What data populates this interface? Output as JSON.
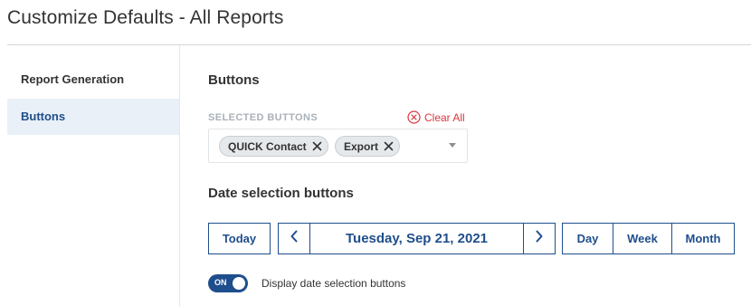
{
  "page": {
    "title": "Customize Defaults - All Reports"
  },
  "sidebar": {
    "items": [
      {
        "label": "Report Generation",
        "active": false
      },
      {
        "label": "Buttons",
        "active": true
      }
    ]
  },
  "buttons_section": {
    "title": "Buttons",
    "selected_label": "SELECTED BUTTONS",
    "clear_all": "Clear All",
    "chips": [
      "QUICK Contact",
      "Export"
    ]
  },
  "date_section": {
    "title": "Date selection buttons",
    "today": "Today",
    "date": "Tuesday, Sep 21, 2021",
    "views": [
      "Day",
      "Week",
      "Month"
    ],
    "toggle": {
      "state": "ON",
      "label": "Display date selection buttons"
    }
  },
  "colors": {
    "primary": "#1f4e8c",
    "danger": "#d9363e",
    "sidebar_active_bg": "#e9f0f7"
  }
}
